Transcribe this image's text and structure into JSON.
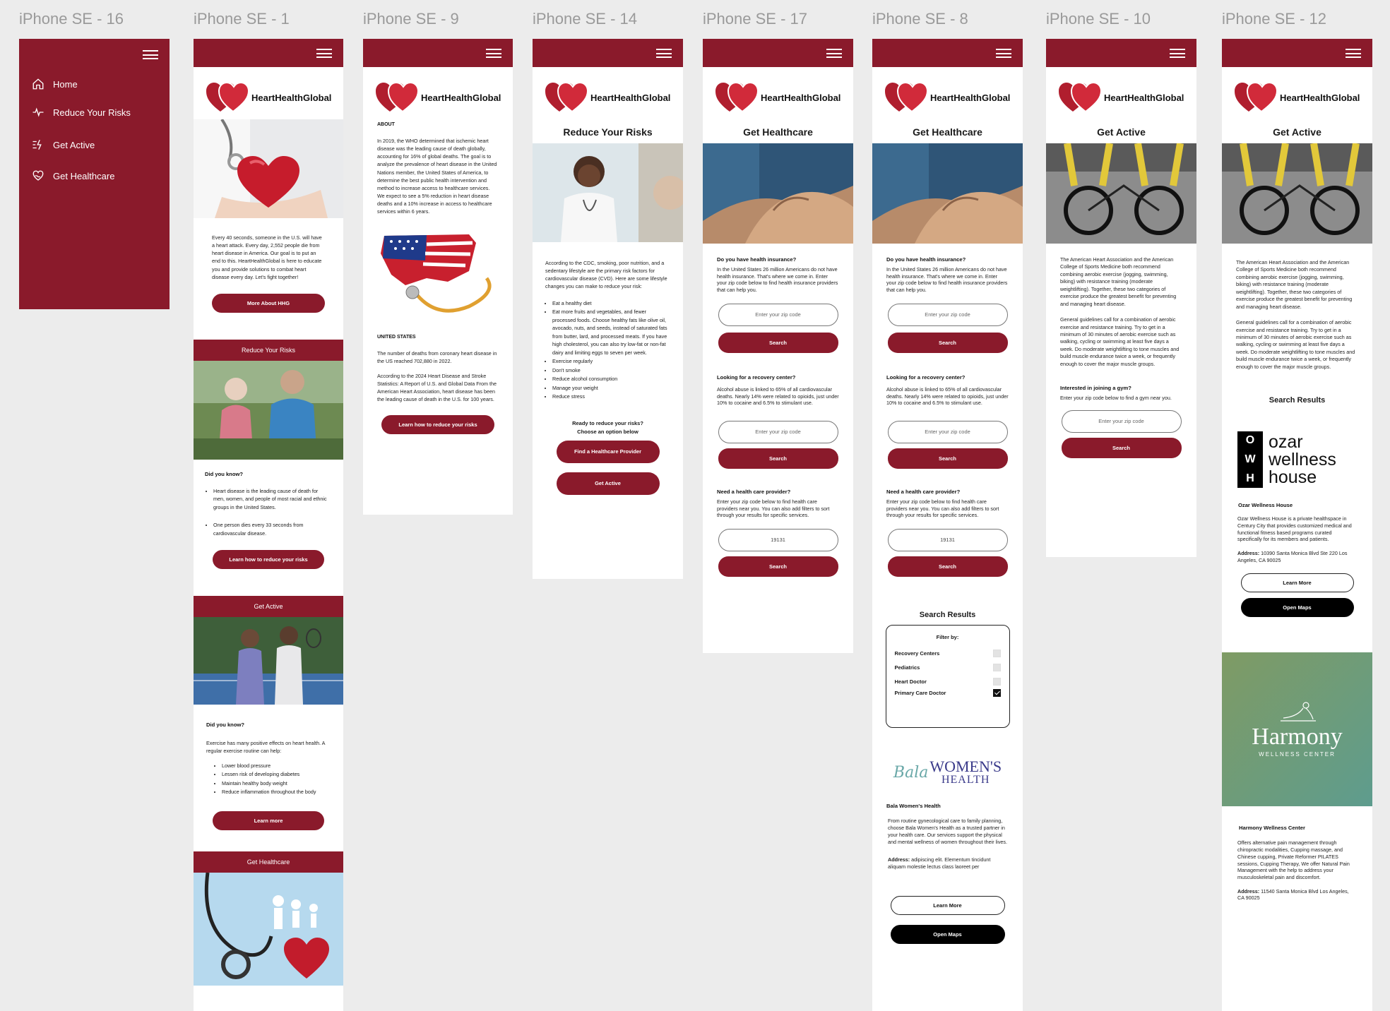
{
  "brand": {
    "name": "HeartHealthGlobal",
    "accent": "#8a1a2b"
  },
  "frames": {
    "f16": "iPhone SE - 16",
    "f1": "iPhone SE - 1",
    "f9": "iPhone SE - 9",
    "f14": "iPhone SE - 14",
    "f17": "iPhone SE - 17",
    "f8": "iPhone SE - 8",
    "f10": "iPhone SE - 10",
    "f12": "iPhone SE - 12"
  },
  "menu": {
    "items": [
      {
        "label": "Home",
        "icon": "home-icon"
      },
      {
        "label": "Reduce Your Risks",
        "icon": "pulse-icon"
      },
      {
        "label": "Get Active",
        "icon": "activity-list-icon"
      },
      {
        "label": "Get Healthcare",
        "icon": "heart-hand-icon"
      }
    ]
  },
  "home": {
    "intro": "Every 40 seconds, someone in the U.S. will have a heart attack. Every day, 2,552 people die from heart disease in America. Our goal is to put an end to this. HeartHealthGlobal is here to educate you and provide solutions to combat heart disease every day. Let's fight together!",
    "more_btn": "More About HHG",
    "risks_band": "Reduce Your Risks",
    "did_you_know": "Did you know?",
    "risk_facts": [
      "Heart disease is the leading cause of death for men, women, and people of most racial and ethnic groups in the United States.",
      "One person dies every 33 seconds from cardiovascular disease."
    ],
    "risks_btn": "Learn how to reduce your risks",
    "active_band": "Get Active",
    "did_you_know2": "Did you know?",
    "exercise_text": "Exercise has many positive effects on heart health. A regular exercise routine can help:",
    "exercise_list": [
      "Lower blood pressure",
      "Lessen risk of developing diabetes",
      "Maintain healthy body weight",
      "Reduce inflammation throughout the body"
    ],
    "learn_more": "Learn more",
    "healthcare_band": "Get Healthcare"
  },
  "about": {
    "heading": "ABOUT",
    "text": "In 2019, the WHO determined that ischemic heart disease was the leading cause of death globally, accounting for 16% of global deaths. The goal is to analyze the prevalence of heart disease in the United Nations member, the United States of America, to determine the best public health intervention and method to increase access to healthcare services. We expect to see a 5% reduction in heart disease deaths and a 10% increase in access to healthcare services within 6 years.",
    "us_heading": "UNITED STATES",
    "us_text1": "The number of deaths from coronary heart disease in the US reached 702,880 in 2022.",
    "us_text2": "According to the 2024 Heart Disease and Stroke Statistics: A Report of U.S. and Global Data From the American Heart Association, heart disease has been the leading cause of death in the U.S. for 100 years.",
    "btn": "Learn how to reduce your risks"
  },
  "risks": {
    "title": "Reduce Your Risks",
    "text": "According to the CDC, smoking, poor nutrition, and a sedentary lifestyle are the primary risk factors for cardiovascular disease (CVD). Here are some lifestyle changes you can make to reduce your risk:",
    "list": [
      "Eat a healthy diet",
      "Eat more fruits and vegetables, and fewer processed foods. Choose healthy fats like olive oil, avocado, nuts, and seeds, instead of saturated fats from butter, lard, and processed meats. If you have high cholesterol, you can also try low-fat or non-fat dairy and limiting eggs to seven per week.",
      "Exercise regularly",
      "Don't smoke",
      "Reduce alcohol consumption",
      "Manage your weight",
      "Reduce stress"
    ],
    "ready": "Ready to reduce your risks?",
    "choose": "Choose an option below",
    "btn1": "Find a Healthcare Provider",
    "btn2": "Get Active"
  },
  "healthcare": {
    "title": "Get Healthcare",
    "q1": "Do you have health insurance?",
    "t1": "In the United States 26 million Americans do not have health insurance. That's where we come in. Enter your zip code below to find health insurance providers that can help you.",
    "zip_placeholder": "Enter your zip code",
    "search": "Search",
    "q2": "Looking for a recovery center?",
    "t2": "Alcohol abuse is linked to 65% of all cardiovascular deaths.  Nearly 14% were related to opioids, just under 10% to cocaine and 6.5% to stimulant use.",
    "q3": "Need a health care provider?",
    "t3": "Enter your zip code below to find health care providers near you. You can also add filters to sort through your results for specific services.",
    "zip_value": "19131"
  },
  "results8": {
    "title": "Search Results",
    "filter_by": "Filter by:",
    "filters": [
      {
        "label": "Recovery Centers",
        "checked": false
      },
      {
        "label": "Pediatrics",
        "checked": false
      },
      {
        "label": "Heart Doctor",
        "checked": false
      },
      {
        "label": "Primary Care Doctor",
        "checked": true
      }
    ],
    "logo_script": "Bala",
    "logo_line1": "WOMEN'S",
    "logo_line2": "HEALTH",
    "name": "Bala Women's Health",
    "desc": "From routine gynecological care to family planning, choose Bala Women's Health as a trusted partner in your health care. Our services support the physical and mental wellness of women throughout their lives.",
    "address_label": "Address:",
    "address": "adipiscing elit. Elementum tincidunt aliquam molestie lectus class laoreet per",
    "learn": "Learn More",
    "maps": "Open Maps"
  },
  "active": {
    "title": "Get Active",
    "text1": "The American Heart Association and the American College of Sports Medicine both recommend combining aerobic exercise (jogging, swimming, biking) with resistance training (moderate weightlifting). Together, these two categories of exercise produce the greatest benefit for preventing and managing heart disease.",
    "text2": "General guidelines call for a combination of aerobic exercise and resistance training. Try to get in a minimum of 30 minutes of aerobic exercise such as walking, cycling or swimming at least five days a week. Do moderate weightlifting to tone muscles and build muscle endurance twice a week, or frequently enough to cover the major muscle groups.",
    "gym_q": "Interested in joining a gym?",
    "gym_t": "Enter your zip code below to find a gym near you.",
    "zip_placeholder": "Enter your zip code",
    "search": "Search"
  },
  "results12": {
    "title": "Search Results",
    "logo_letters": [
      "O",
      "W",
      "H"
    ],
    "logo_words": [
      "ozar",
      "wellness",
      "house"
    ],
    "name1": "Ozar Wellness House",
    "desc1": "Ozar Wellness House is a private healthspace in Century City that provides customized medical and functional fitness based programs curated specifically for its members and patients.",
    "address_label": "Address:",
    "address1": "10390 Santa Monica Blvd Ste 220 Los Angeles, CA 90025",
    "learn": "Learn More",
    "maps": "Open Maps",
    "harmony": "Harmony",
    "harmony_sub": "WELLNESS CENTER",
    "name2": "Harmony Wellness Center",
    "desc2": "Offers alternative pain management through chiropractic modalities, Cupping massage, and Chinese cupping, Private Reformer PILATES sessions, Cupping Therapy, We offer Natural Pain Management with the help to address your musculoskeletal pain and discomfort.",
    "address2": "11540 Santa Monica Blvd Los Angeles, CA 90025"
  }
}
